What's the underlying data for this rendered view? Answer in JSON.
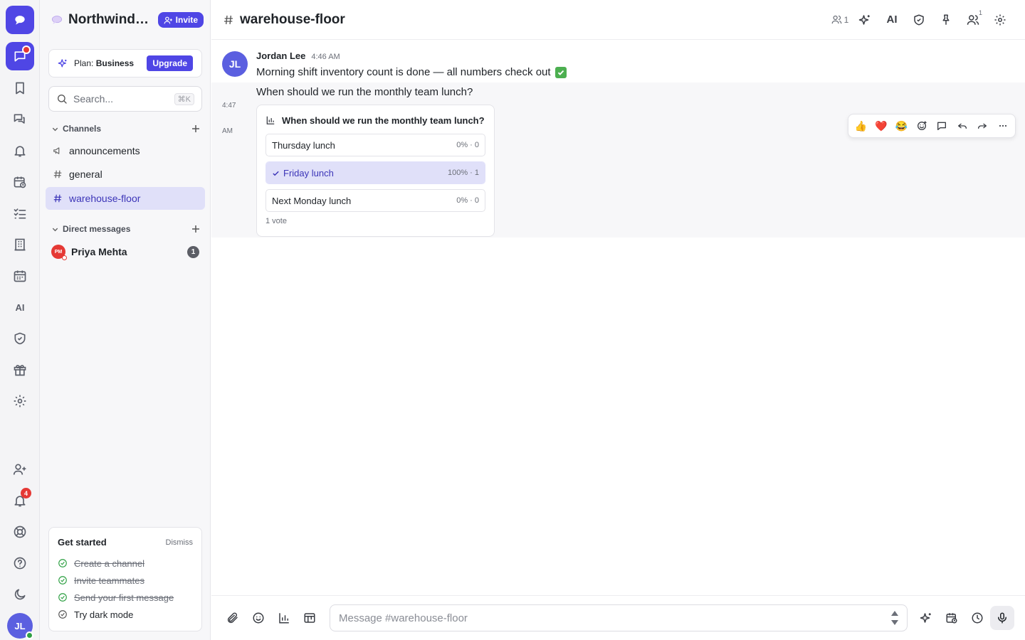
{
  "workspace": {
    "name": "Northwind Logistics",
    "invite_label": "Invite"
  },
  "plan": {
    "prefix": "Plan:",
    "name": "Business",
    "upgrade_label": "Upgrade"
  },
  "search": {
    "placeholder": "Search...",
    "shortcut": "⌘K"
  },
  "channels": {
    "header": "Channels",
    "items": [
      {
        "name": "announcements",
        "icon": "megaphone-icon"
      },
      {
        "name": "general",
        "icon": "hash-icon"
      },
      {
        "name": "warehouse-floor",
        "icon": "hash-icon",
        "active": true
      }
    ]
  },
  "direct_messages": {
    "header": "Direct messages",
    "items": [
      {
        "name": "Priya Mehta",
        "initials": "PM",
        "unread": "1",
        "avatar_color": "#e53935"
      }
    ]
  },
  "get_started": {
    "title": "Get started",
    "dismiss_label": "Dismiss",
    "items": [
      {
        "label": "Create a channel",
        "done": true
      },
      {
        "label": "Invite teammates",
        "done": true
      },
      {
        "label": "Send your first message",
        "done": true
      },
      {
        "label": "Try dark mode",
        "done": false
      }
    ]
  },
  "rail": {
    "logo_icon": "chat-bubble-icon",
    "items": [
      "chat-icon",
      "bookmark-icon",
      "threads-icon",
      "bell-icon",
      "calendar-clock-icon",
      "checklist-icon",
      "building-icon",
      "calendar-icon",
      "ai-icon",
      "shield-icon",
      "gift-icon",
      "gear-icon"
    ],
    "ai_label": "AI",
    "bottom_items": [
      "add-user-icon",
      "bell-icon",
      "lifebuoy-icon",
      "help-icon",
      "moon-icon"
    ],
    "notification_badge": "4",
    "user_initials": "JL"
  },
  "header": {
    "channel_name": "warehouse-floor",
    "member_count": "1",
    "ai_label": "AI",
    "people_count": "1"
  },
  "messages": [
    {
      "author": "Jordan Lee",
      "initials": "JL",
      "time": "4:46 AM",
      "text": "Morning shift inventory count is done — all numbers check out",
      "emoji": "check-mark-emoji"
    },
    {
      "time_short": "4:47",
      "time_ampm": "AM",
      "text": "When should we run the monthly team lunch?",
      "poll": {
        "title": "When should we run the monthly team lunch?",
        "options": [
          {
            "label": "Thursday lunch",
            "stat": "0% · 0",
            "percent": 0,
            "selected": false
          },
          {
            "label": "Friday lunch",
            "stat": "100% · 1",
            "percent": 100,
            "selected": true
          },
          {
            "label": "Next Monday lunch",
            "stat": "0% · 0",
            "percent": 0,
            "selected": false
          }
        ],
        "total": "1 vote"
      }
    }
  ],
  "reactions": {
    "quick": [
      "👍",
      "❤️",
      "😂"
    ]
  },
  "composer": {
    "placeholder": "Message #warehouse-floor"
  },
  "colors": {
    "accent": "#4f46e5",
    "active_bg": "#e0e0f9",
    "success": "#2ea043",
    "alert": "#e53935"
  }
}
